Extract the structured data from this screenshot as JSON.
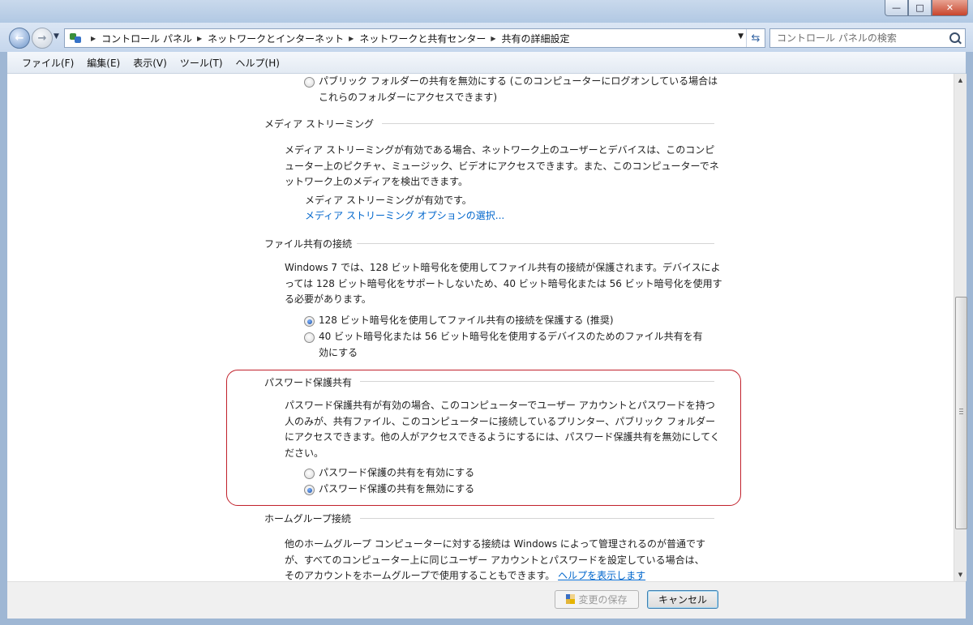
{
  "window": {
    "minimize": "—",
    "maximize": "□",
    "close": "✕"
  },
  "nav": {
    "back_glyph": "←",
    "forward_glyph": "→",
    "dropdown_glyph": "▼"
  },
  "address": {
    "crumbs": [
      "コントロール パネル",
      "ネットワークとインターネット",
      "ネットワークと共有センター",
      "共有の詳細設定"
    ],
    "dropdown_glyph": "▼",
    "refresh_glyph": "⇆"
  },
  "search": {
    "placeholder": "コントロール パネルの検索"
  },
  "menubar": [
    "ファイル(F)",
    "編集(E)",
    "表示(V)",
    "ツール(T)",
    "ヘルプ(H)"
  ],
  "content": {
    "public_folder_option": "パブリック フォルダーの共有を無効にする (このコンピューターにログオンしている場合はこれらのフォルダーにアクセスできます)",
    "media": {
      "title": "メディア ストリーミング",
      "description": "メディア ストリーミングが有効である場合、ネットワーク上のユーザーとデバイスは、このコンピューター上のピクチャ、ミュージック、ビデオにアクセスできます。また、このコンピューターでネットワーク上のメディアを検出できます。",
      "status": "メディア ストリーミングが有効です。",
      "link": "メディア ストリーミング オプションの選択..."
    },
    "file_sharing": {
      "title": "ファイル共有の接続",
      "description": "Windows 7 では、128 ビット暗号化を使用してファイル共有の接続が保護されます。デバイスによっては 128 ビット暗号化をサポートしないため、40 ビット暗号化または 56 ビット暗号化を使用する必要があります。",
      "option_128": "128 ビット暗号化を使用してファイル共有の接続を保護する (推奨)",
      "option_40": "40 ビット暗号化または 56 ビット暗号化を使用するデバイスのためのファイル共有を有効にする"
    },
    "password": {
      "title": "パスワード保護共有",
      "description": "パスワード保護共有が有効の場合、このコンピューターでユーザー アカウントとパスワードを持つ人のみが、共有ファイル、このコンピューターに接続しているプリンター、パブリック フォルダーにアクセスできます。他の人がアクセスできるようにするには、パスワード保護共有を無効にしてください。",
      "enable": "パスワード保護の共有を有効にする",
      "disable": "パスワード保護の共有を無効にする"
    },
    "homegroup": {
      "title": "ホームグループ接続",
      "description": "他のホームグループ コンピューターに対する接続は Windows によって管理されるのが普通ですが、すべてのコンピューター上に同じユーザー アカウントとパスワードを設定している場合は、そのアカウントをホームグループで使用することもできます。",
      "help_link": "ヘルプを表示します"
    }
  },
  "buttons": {
    "save": "変更の保存",
    "cancel": "キャンセル"
  },
  "scroll": {
    "up": "▲",
    "down": "▼"
  }
}
